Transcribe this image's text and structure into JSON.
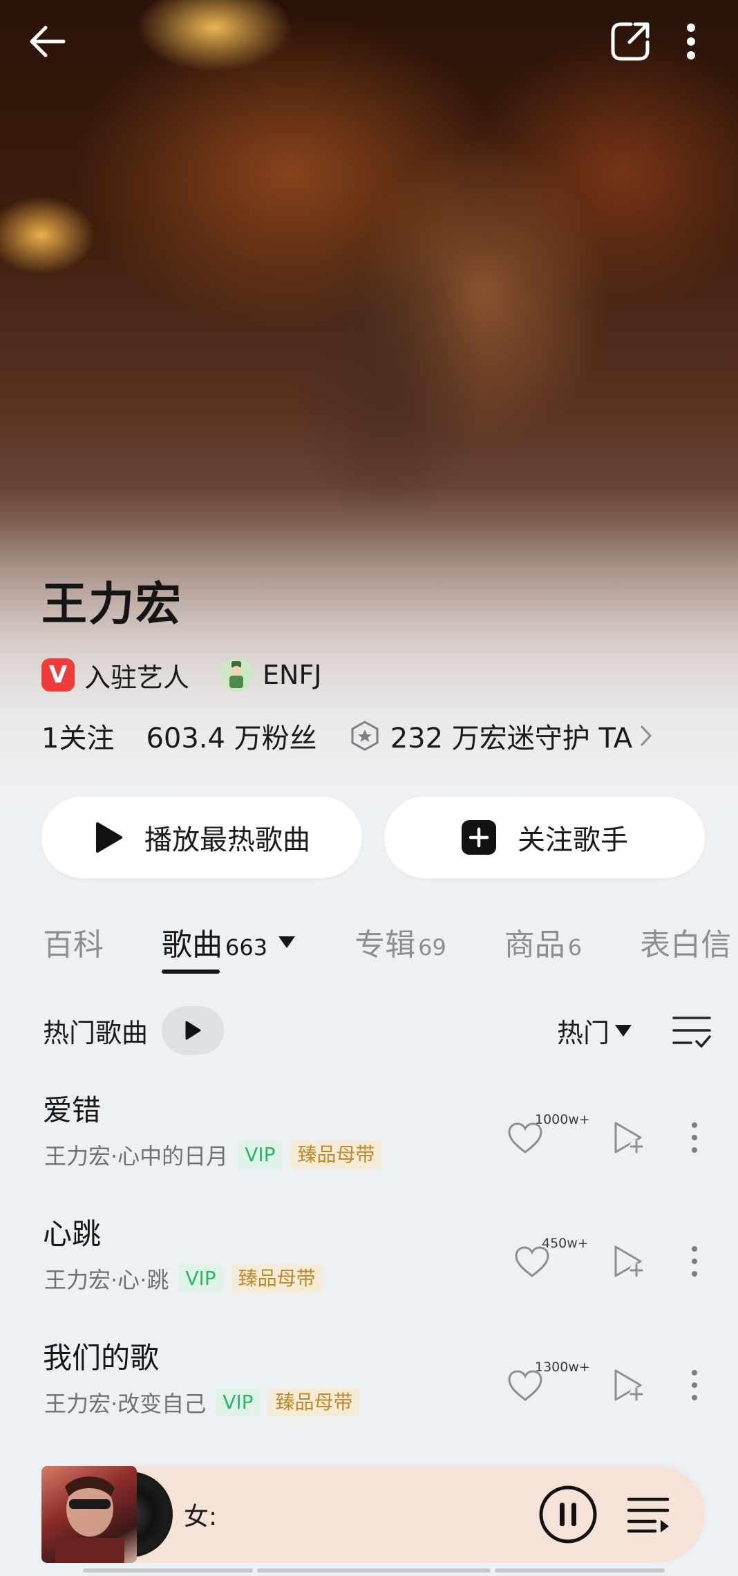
{
  "header": {
    "back_icon": "arrow-left-icon",
    "share_icon": "share-icon",
    "more_icon": "more-vertical-icon"
  },
  "artist": {
    "name": "王力宏",
    "verified_badge_letter": "V",
    "verified_label": "入驻艺人",
    "mbti": "ENFJ",
    "following": "1关注",
    "fans": "603.4 万粉丝",
    "guard": "232 万宏迷守护 TA"
  },
  "actions": {
    "play_hot": "播放最热歌曲",
    "follow": "关注歌手"
  },
  "tabs": [
    {
      "label": "百科",
      "count": ""
    },
    {
      "label": "歌曲",
      "count": "663"
    },
    {
      "label": "专辑",
      "count": "69"
    },
    {
      "label": "商品",
      "count": "6"
    },
    {
      "label": "表白信",
      "count": ""
    }
  ],
  "songs_header": {
    "title": "热门歌曲",
    "sort_label": "热门"
  },
  "songs": [
    {
      "title": "爱错",
      "meta": "王力宏·心中的日月",
      "vip": "VIP",
      "quality": "臻品母带",
      "likes": "1000w+"
    },
    {
      "title": "心跳",
      "meta": "王力宏·心·跳",
      "vip": "VIP",
      "quality": "臻品母带",
      "likes": "450w+"
    },
    {
      "title": "我们的歌",
      "meta": "王力宏·改变自己",
      "vip": "VIP",
      "quality": "臻品母带",
      "likes": "1300w+"
    }
  ],
  "mini_player": {
    "title": "女:",
    "pause_icon": "pause-icon",
    "queue_icon": "playlist-icon"
  },
  "colors": {
    "vip_green": "#2eb46a",
    "master_gold": "#c08a2c",
    "verified_red": "#ef3b3b"
  }
}
